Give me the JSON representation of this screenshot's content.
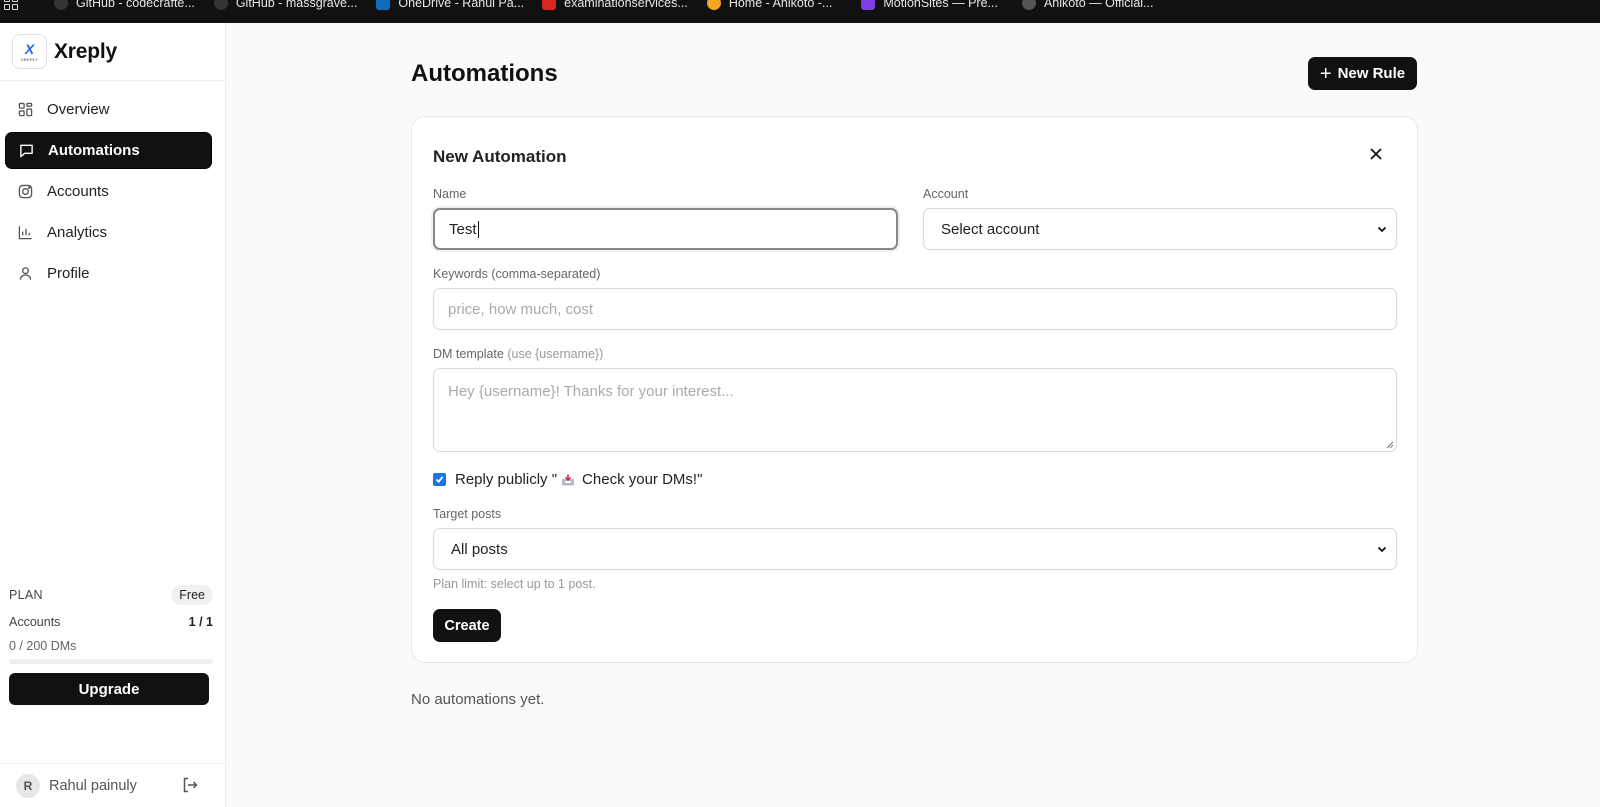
{
  "bookmarks": [
    {
      "label": "GitHub - codecrafte...",
      "color": "#333333"
    },
    {
      "label": "GitHub - massgrave...",
      "color": "#333333"
    },
    {
      "label": "OneDrive - Rahul Pa...",
      "color": "#0f6cbd"
    },
    {
      "label": "examinationservices...",
      "color": "#d6281e"
    },
    {
      "label": "Home - Anikoto -...",
      "color": "#f5a623"
    },
    {
      "label": "MotionSites — Pre...",
      "color": "#7b3fe4"
    },
    {
      "label": "Anikoto — Official...",
      "color": "#555555"
    }
  ],
  "sidebar": {
    "brand": "Xreply",
    "logo_text": "XREPLY",
    "nav": [
      {
        "label": "Overview",
        "icon": "grid-icon"
      },
      {
        "label": "Automations",
        "icon": "message-icon",
        "active": true
      },
      {
        "label": "Accounts",
        "icon": "instagram-icon"
      },
      {
        "label": "Analytics",
        "icon": "bar-chart-icon"
      },
      {
        "label": "Profile",
        "icon": "user-icon"
      }
    ],
    "plan": {
      "label": "PLAN",
      "badge": "Free",
      "accounts_label": "Accounts",
      "accounts_value": "1 / 1",
      "dms": "0 / 200 DMs",
      "dms_fraction": 0,
      "upgrade": "Upgrade"
    },
    "user": {
      "initial": "R",
      "name": "Rahul painuly"
    }
  },
  "main": {
    "title": "Automations",
    "new_rule": "New Rule",
    "empty": "No automations yet."
  },
  "form": {
    "title": "New Automation",
    "name_label": "Name",
    "name_value": "Test",
    "account_label": "Account",
    "account_value": "Select account",
    "keywords_label": "Keywords (comma-separated)",
    "keywords_placeholder": "price, how much, cost",
    "dm_label": "DM template",
    "dm_hint": "(use {username})",
    "dm_placeholder": "Hey {username}! Thanks for your interest...",
    "reply_checked": true,
    "reply_prefix": "Reply publicly \"",
    "reply_suffix": "Check your DMs!\"",
    "target_label": "Target posts",
    "target_value": "All posts",
    "limit_text": "Plan limit: select up to 1 post.",
    "create": "Create"
  },
  "colors": {
    "accent": "#111111",
    "checkbox": "#1a73e8",
    "logo": "#2563eb"
  }
}
